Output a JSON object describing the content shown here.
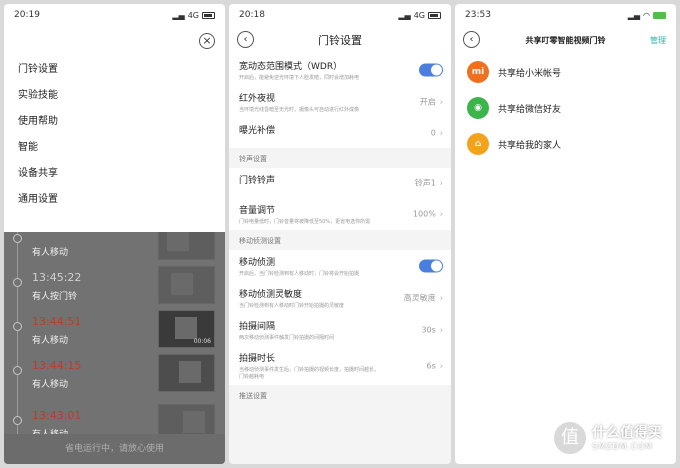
{
  "phone1": {
    "time": "20:19",
    "signal": "4G",
    "menu_items": [
      "门铃设置",
      "实验技能",
      "使用帮助",
      "智能",
      "设备共享",
      "通用设置"
    ],
    "timeline": [
      {
        "time": "",
        "label": "有人移动",
        "red": false
      },
      {
        "time": "13:45:22",
        "label": "有人按门铃",
        "red": false
      },
      {
        "time": "13:44:51",
        "label": "有人移动",
        "red": true,
        "duration": "00:06"
      },
      {
        "time": "13:44:15",
        "label": "有人移动",
        "red": true
      },
      {
        "time": "13:43:01",
        "label": "有人移动",
        "red": true
      }
    ],
    "footer": "省电运行中，请放心使用"
  },
  "phone2": {
    "time": "20:18",
    "signal": "4G",
    "title": "门铃设置",
    "wdr": {
      "title": "宽动态范围模式（WDR）",
      "desc": "开启后，能避免逆光环境下人脸发暗，同时会增加耗电"
    },
    "night": {
      "title": "红外夜视",
      "desc": "当环境光线昏暗至无光时，摄像头可自动进行红外成像",
      "value": "开启"
    },
    "exposure": {
      "title": "曝光补偿",
      "value": "0"
    },
    "sec_ring": "铃声设置",
    "ringtone": {
      "title": "门铃铃声",
      "value": "铃声1"
    },
    "volume": {
      "title": "音量调节",
      "desc": "门铃电量低时，门铃音量将被降低至50%，更省电选你所需",
      "value": "100%"
    },
    "sec_motion": "移动侦测设置",
    "motion": {
      "title": "移动侦测",
      "desc": "开启后，当门铃检测到有人移动时，门铃将会开始拍摄"
    },
    "sensitivity": {
      "title": "移动侦测灵敏度",
      "desc": "当门铃检测到有人移动时门铃开始拍摄的灵敏度",
      "value": "高灵敏度"
    },
    "interval": {
      "title": "拍摄间隔",
      "desc": "两次移动侦测事件触发门铃拍摄的间隔时间",
      "value": "30s"
    },
    "duration": {
      "title": "拍摄时长",
      "desc": "当移动侦测事件发生后，门铃拍摄的视频长度，拍摄时间越长，门铃越耗电",
      "value": "6s"
    },
    "sec_push": "推送设置"
  },
  "phone3": {
    "time": "23:53",
    "title": "共享叮零智能视频门铃",
    "manage": "管理",
    "items": [
      {
        "label": "共享给小米帐号",
        "icon": "mi-icon",
        "color": "#f07020",
        "glyph": "mi"
      },
      {
        "label": "共享给微信好友",
        "icon": "wechat-icon",
        "color": "#3bb54a",
        "glyph": "◉"
      },
      {
        "label": "共享给我的家人",
        "icon": "home-icon",
        "color": "#f3a21d",
        "glyph": "⌂"
      }
    ]
  },
  "watermark": {
    "brand": "什么值得买",
    "site": "SMZDM.COM"
  }
}
